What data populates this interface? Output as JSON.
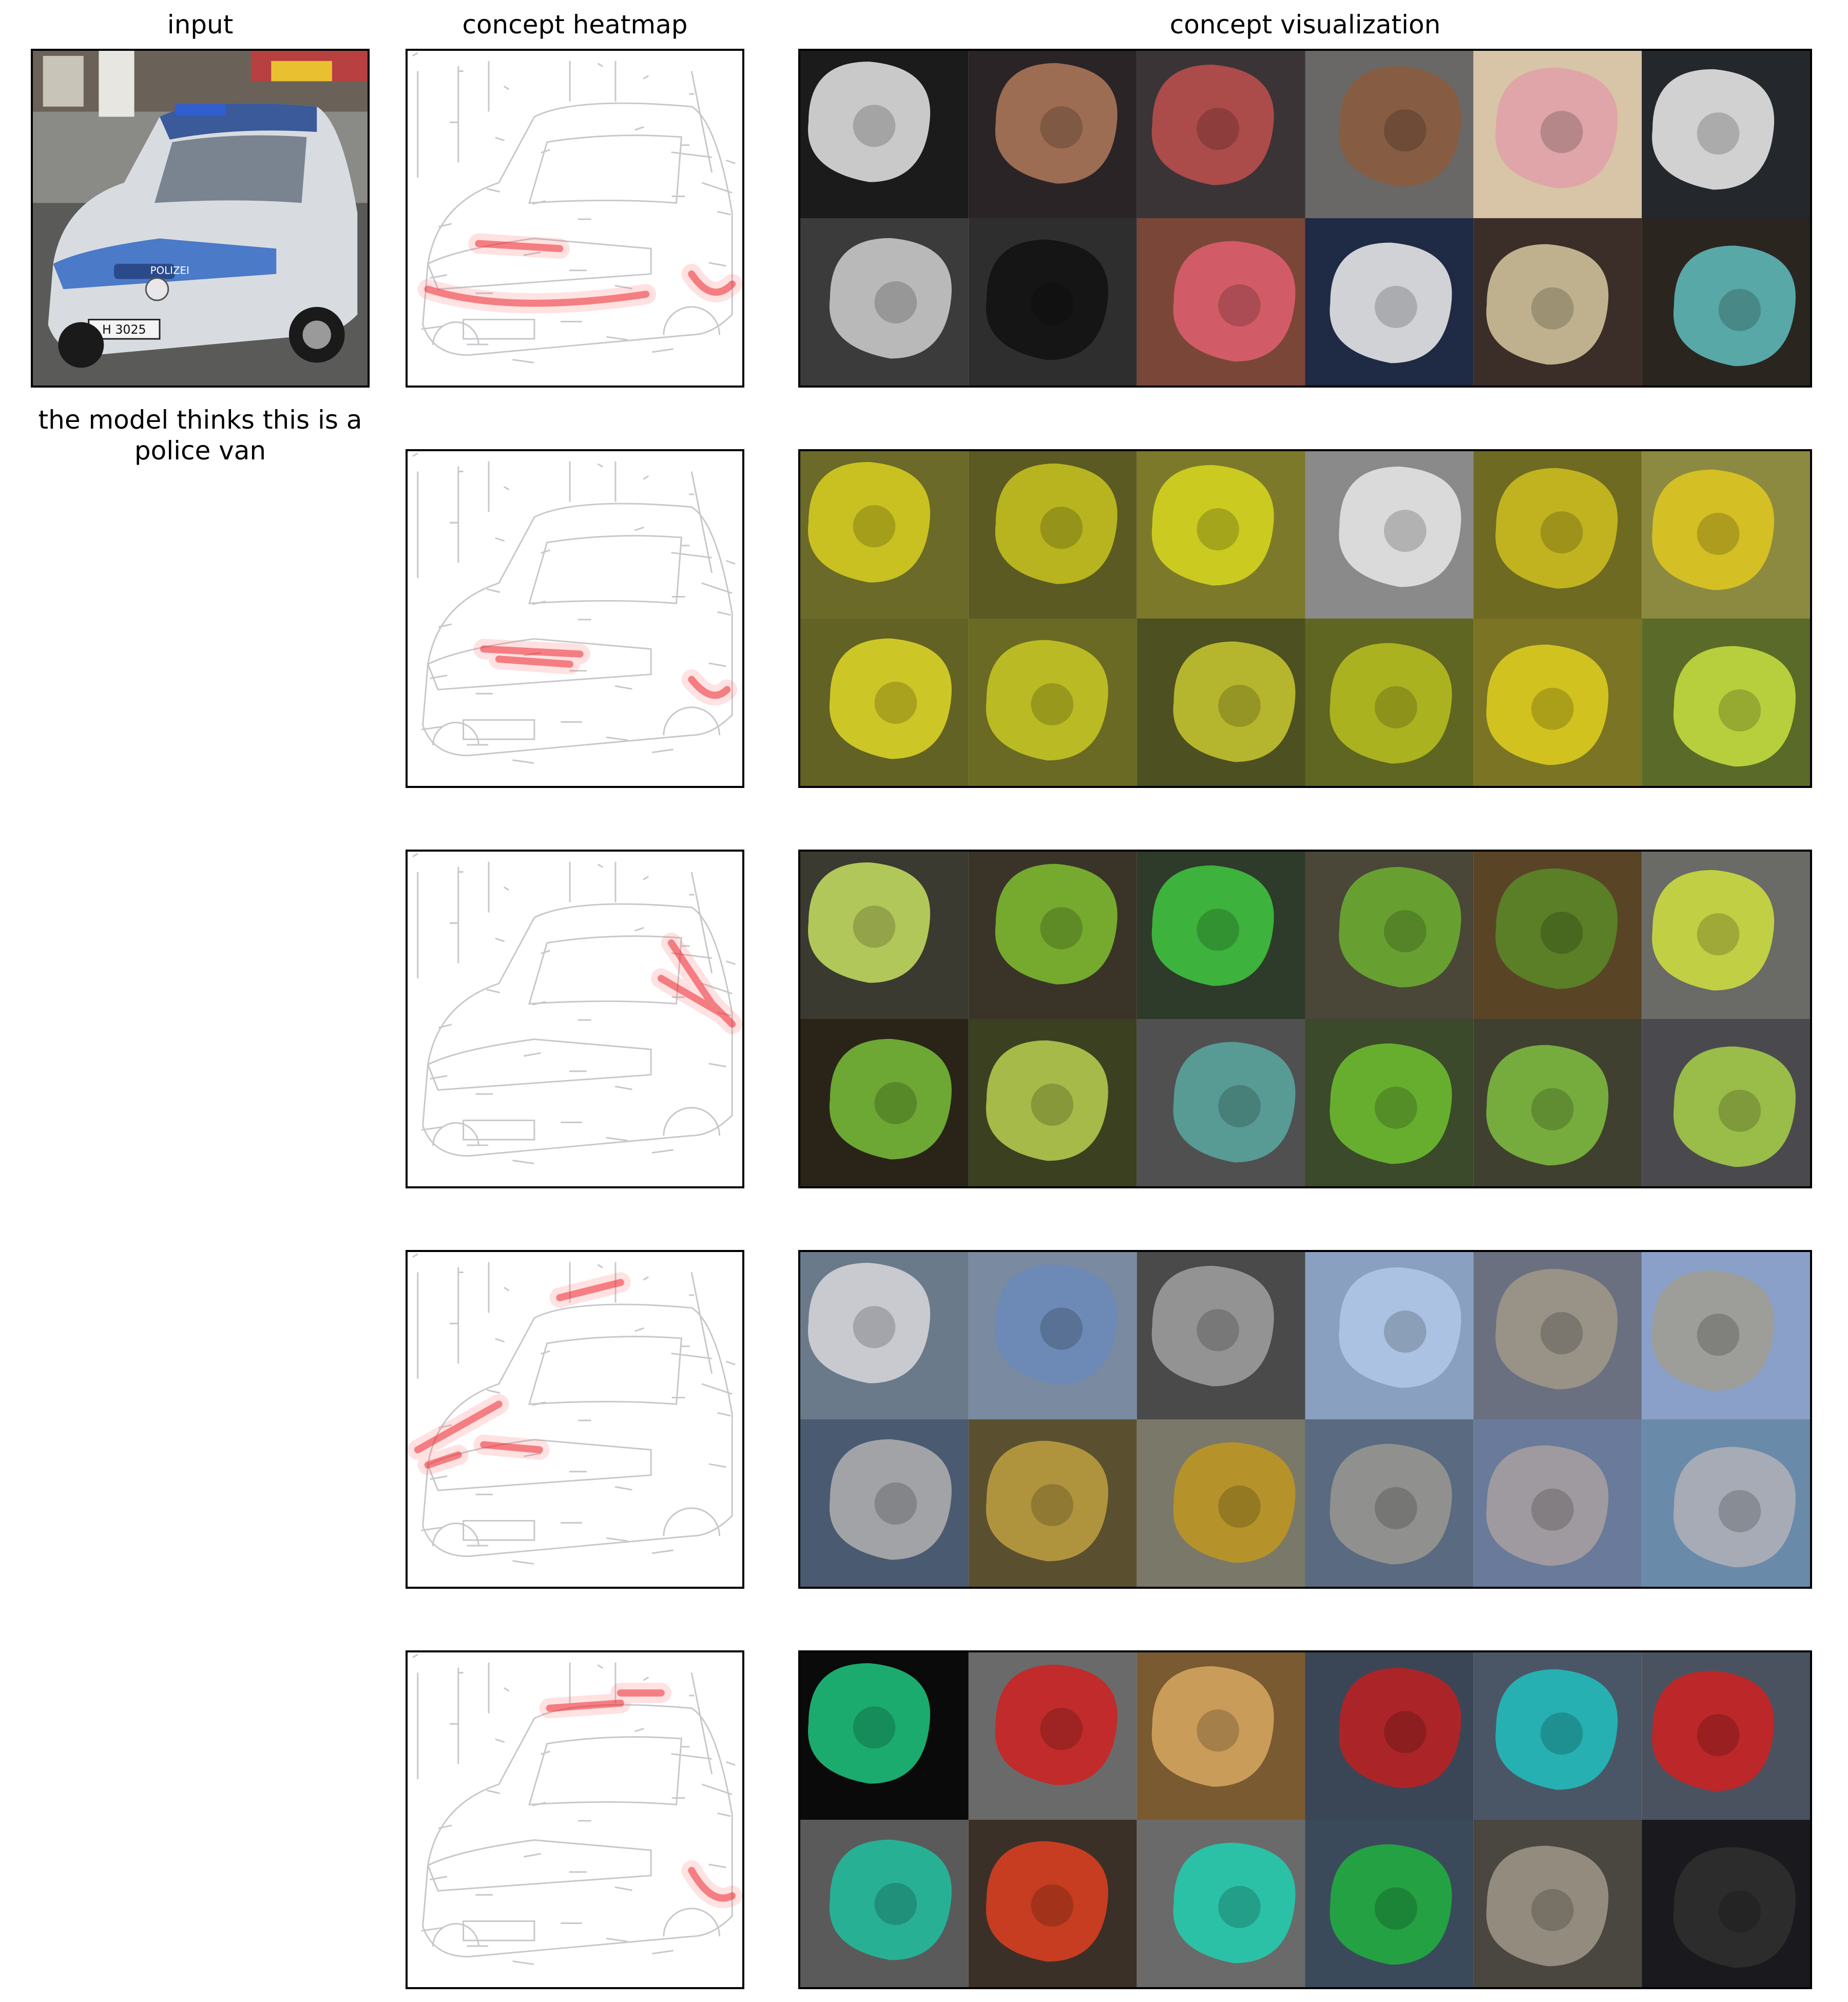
{
  "titles": {
    "input": "input",
    "heatmap": "concept heatmap",
    "visualization": "concept visualization"
  },
  "input_image": {
    "description_icon": "police-car-photo",
    "plate_text": "H 3025",
    "badge_text": "POLIZEI"
  },
  "prediction": {
    "text": "the model thinks this is a police van"
  },
  "concepts": [
    {
      "id": "concept-1",
      "heatmap_focus": "front-bumper-and-wheel-arches",
      "tile_colors": [
        "#1b1b1b",
        "#2a2426",
        "#3a3436",
        "#6a6866",
        "#d8c4a6",
        "#24272c",
        "#3b3b3b",
        "#2e2e2e",
        "#7a4638",
        "#1f2a44",
        "#3b2e28",
        "#2b2520"
      ],
      "tile_accents": [
        "#e8e8e8",
        "#b07a5c",
        "#c0504d",
        "#8b5a3c",
        "#e0a0a8",
        "#f0f0f0",
        "#d0d0d0",
        "#101010",
        "#e06070",
        "#f0f0f0",
        "#d8c8a0",
        "#60c0c0"
      ]
    },
    {
      "id": "concept-2",
      "heatmap_focus": "grille-emblem",
      "tile_colors": [
        "#6b6a28",
        "#5a5a22",
        "#7c7a2a",
        "#8a8a8a",
        "#6e6a22",
        "#8c8a40",
        "#626224",
        "#6a6a24",
        "#4d5020",
        "#5f6622",
        "#7a7424",
        "#5a6a28"
      ],
      "tile_accents": [
        "#d8d020",
        "#c8c420",
        "#d8d820",
        "#e8e8e8",
        "#d0c020",
        "#e0c820",
        "#e0d828",
        "#c8c824",
        "#c8c830",
        "#b8c020",
        "#e0d020",
        "#c8e040"
      ]
    },
    {
      "id": "concept-3",
      "heatmap_focus": "rear-side-door",
      "tile_colors": [
        "#3a3a30",
        "#3a3428",
        "#2e3a2a",
        "#4a4638",
        "#5a4426",
        "#6a6a66",
        "#2a2418",
        "#3a4020",
        "#505050",
        "#3a4a2a",
        "#404030",
        "#4a4a4e"
      ],
      "tile_accents": [
        "#c8e060",
        "#80c030",
        "#40c840",
        "#6cb030",
        "#5a8a28",
        "#d0e040",
        "#78c038",
        "#b8d050",
        "#58a8a0",
        "#70c030",
        "#80c040",
        "#a8d048"
      ]
    },
    {
      "id": "concept-4",
      "heatmap_focus": "windshield-edge-and-headlight",
      "tile_colors": [
        "#6a7a8a",
        "#7a8aa0",
        "#4a4a4a",
        "#8aa0c0",
        "#6a7080",
        "#8aa0c8",
        "#4a5a70",
        "#5a5030",
        "#7a7868",
        "#5a6a80",
        "#6a7a9a",
        "#6a8aaa"
      ],
      "tile_accents": [
        "#d8d8dc",
        "#6a8ab8",
        "#a0a0a0",
        "#b0c8e8",
        "#a09888",
        "#a09c90",
        "#b0b0b0",
        "#c0a040",
        "#c09820",
        "#9a9890",
        "#a8a0a0",
        "#b0b0b8"
      ]
    },
    {
      "id": "concept-5",
      "heatmap_focus": "roof-light-bar-and-rear",
      "tile_colors": [
        "#0a0a0a",
        "#6a6a6a",
        "#7a5a30",
        "#3a4656",
        "#4a5666",
        "#4a5260",
        "#5a5a5a",
        "#3a3028",
        "#6a6a6a",
        "#3a4a5a",
        "#4a4640",
        "#1a1a1e"
      ],
      "tile_accents": [
        "#20c880",
        "#d02020",
        "#d8a860",
        "#c02020",
        "#20c0c0",
        "#d02020",
        "#20c0a0",
        "#e04020",
        "#20d0b0",
        "#20b040",
        "#a09888",
        "#303030"
      ]
    }
  ]
}
